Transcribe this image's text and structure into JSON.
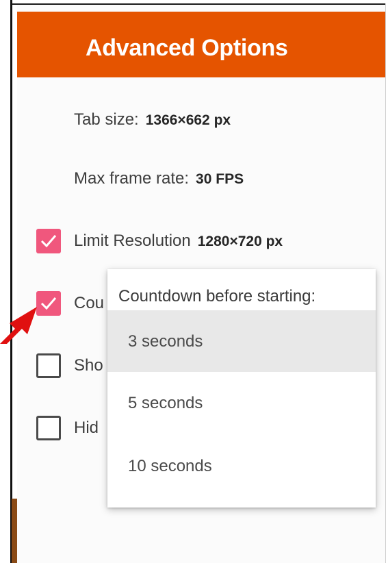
{
  "header": {
    "title": "Advanced Options"
  },
  "info": {
    "tab_size_label": "Tab size:",
    "tab_size_value": "1366×662 px",
    "frame_rate_label": "Max frame rate:",
    "frame_rate_value": "30 FPS"
  },
  "options": [
    {
      "label": "Limit Resolution",
      "value": "1280×720 px",
      "checked": true
    },
    {
      "label": "Cou",
      "checked": true
    },
    {
      "label": "Sho",
      "checked": false
    },
    {
      "label": "Hid",
      "checked": false
    }
  ],
  "dropdown": {
    "title": "Countdown before starting:",
    "items": [
      "3 seconds",
      "5 seconds",
      "10 seconds"
    ],
    "selected": "3 seconds"
  },
  "colors": {
    "header": "#e55400",
    "checkbox_checked": "#f0577d",
    "annotation_arrow": "#e01010"
  }
}
